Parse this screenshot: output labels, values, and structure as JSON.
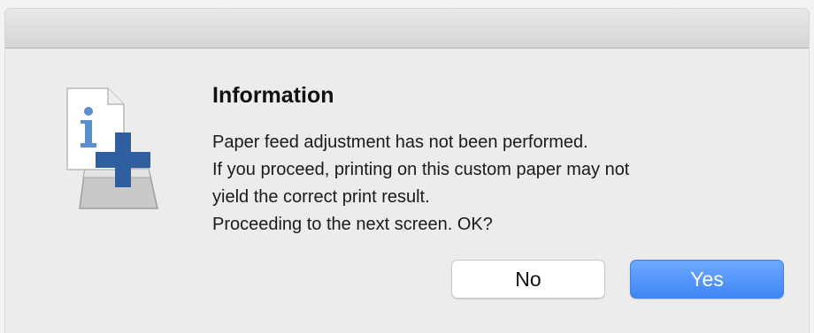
{
  "dialog": {
    "title": "Information",
    "message_lines": [
      "Paper feed adjustment has not been performed.",
      "If you proceed, printing on this custom paper may not",
      "yield the correct print result.",
      "Proceeding to the next screen. OK?"
    ],
    "icon": "paper-feed-info-icon",
    "buttons": {
      "no_label": "No",
      "yes_label": "Yes"
    }
  },
  "colors": {
    "accent_button": "#4a8ff7",
    "plus_sign": "#2f5f9e",
    "info_glyph": "#5d8fcc"
  }
}
